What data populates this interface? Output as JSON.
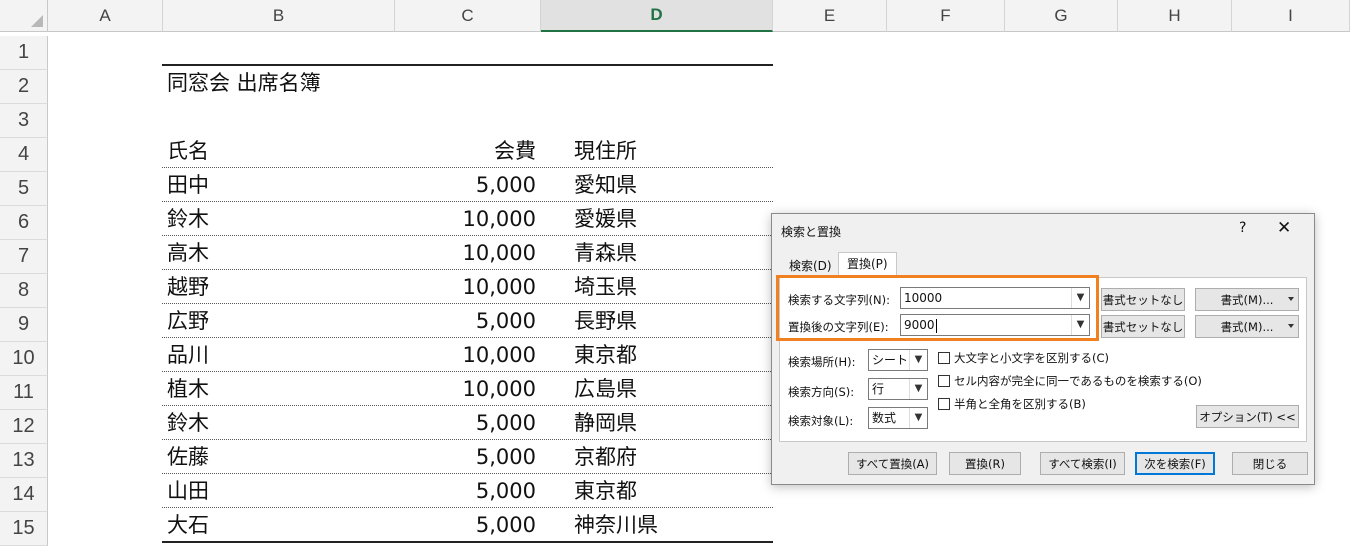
{
  "sheet": {
    "columns": [
      "A",
      "B",
      "C",
      "D",
      "E",
      "F",
      "G",
      "H",
      "I"
    ],
    "active_column": "D",
    "rows": [
      "1",
      "2",
      "3",
      "4",
      "5",
      "6",
      "7",
      "8",
      "9",
      "10",
      "11",
      "12",
      "13",
      "14",
      "15"
    ],
    "title": "同窓会 出席名簿",
    "header": {
      "name": "氏名",
      "fee": "会費",
      "address": "現住所"
    },
    "records": [
      {
        "name": "田中",
        "fee": "5,000",
        "address": "愛知県"
      },
      {
        "name": "鈴木",
        "fee": "10,000",
        "address": "愛媛県"
      },
      {
        "name": "高木",
        "fee": "10,000",
        "address": "青森県"
      },
      {
        "name": "越野",
        "fee": "10,000",
        "address": "埼玉県"
      },
      {
        "name": "広野",
        "fee": "5,000",
        "address": "長野県"
      },
      {
        "name": "品川",
        "fee": "10,000",
        "address": "東京都"
      },
      {
        "name": "植木",
        "fee": "10,000",
        "address": "広島県"
      },
      {
        "name": "鈴木",
        "fee": "5,000",
        "address": "静岡県"
      },
      {
        "name": "佐藤",
        "fee": "5,000",
        "address": "京都府"
      },
      {
        "name": "山田",
        "fee": "5,000",
        "address": "東京都"
      },
      {
        "name": "大石",
        "fee": "5,000",
        "address": "神奈川県"
      }
    ]
  },
  "dialog": {
    "title": "検索と置換",
    "help": "?",
    "close": "✕",
    "tabs": {
      "find": "検索(D)",
      "replace": "置換(P)"
    },
    "find_label": "検索する文字列(N):",
    "find_value": "10000",
    "replace_label": "置換後の文字列(E):",
    "replace_value": "9000",
    "no_format_label": "書式セットなし",
    "format_label": "書式(M)...",
    "within_label": "検索場所(H):",
    "within_value": "シート",
    "search_label": "検索方向(S):",
    "search_value": "行",
    "lookin_label": "検索対象(L):",
    "lookin_value": "数式",
    "match_case": "大文字と小文字を区別する(C)",
    "match_entire": "セル内容が完全に同一であるものを検索する(O)",
    "match_byte": "半角と全角を区別する(B)",
    "options_label": "オプション(T) <<",
    "replace_all": "すべて置換(A)",
    "replace": "置換(R)",
    "find_all": "すべて検索(I)",
    "find_next": "次を検索(F)",
    "close_btn": "閉じる",
    "highlight_color": "#f08020"
  }
}
